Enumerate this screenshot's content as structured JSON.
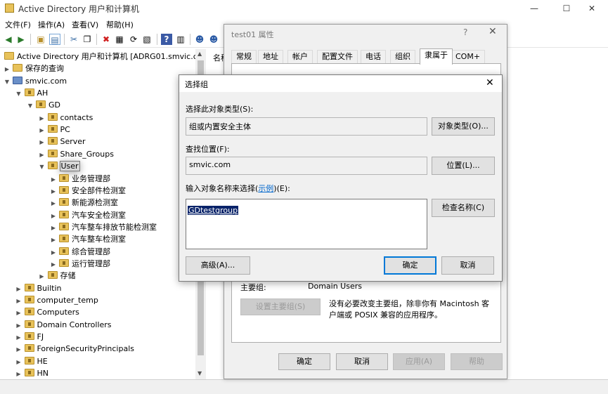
{
  "window": {
    "title": "Active Directory 用户和计算机",
    "min": "—",
    "max": "☐",
    "close": "✕"
  },
  "menu": [
    "文件(F)",
    "操作(A)",
    "查看(V)",
    "帮助(H)"
  ],
  "tree": {
    "root": "Active Directory 用户和计算机 [ADRG01.smvic.com]",
    "saved_queries": "保存的查询",
    "domain": "smvic.com",
    "nodes": [
      {
        "label": "AH",
        "level": 1,
        "expanded": true
      },
      {
        "label": "GD",
        "level": 2,
        "expanded": true
      },
      {
        "label": "contacts",
        "level": 3
      },
      {
        "label": "PC",
        "level": 3
      },
      {
        "label": "Server",
        "level": 3
      },
      {
        "label": "Share_Groups",
        "level": 3
      },
      {
        "label": "User",
        "level": 3,
        "expanded": true,
        "selected": true
      },
      {
        "label": "业务管理部",
        "level": 4
      },
      {
        "label": "安全部件检测室",
        "level": 4
      },
      {
        "label": "新能源检测室",
        "level": 4
      },
      {
        "label": "汽车安全检测室",
        "level": 4
      },
      {
        "label": "汽车整车排放节能检测室",
        "level": 4
      },
      {
        "label": "汽车整车检测室",
        "level": 4
      },
      {
        "label": "综合管理部",
        "level": 4
      },
      {
        "label": "运行管理部",
        "level": 4
      },
      {
        "label": "存储",
        "level": 3
      },
      {
        "label": "Builtin",
        "level": 1
      },
      {
        "label": "computer_temp",
        "level": 1
      },
      {
        "label": "Computers",
        "level": 1
      },
      {
        "label": "Domain Controllers",
        "level": 1
      },
      {
        "label": "FJ",
        "level": 1
      },
      {
        "label": "ForeignSecurityPrincipals",
        "level": 1
      },
      {
        "label": "HE",
        "level": 1
      },
      {
        "label": "HN",
        "level": 1
      }
    ]
  },
  "right_pane": {
    "column": "名称"
  },
  "props": {
    "title": "test01 属性",
    "help": "?",
    "close": "✕",
    "tabs": [
      "常规",
      "地址",
      "帐户",
      "配置文件",
      "电话",
      "组织",
      "隶属于",
      "COM+"
    ],
    "primary_group_label": "主要组:",
    "primary_group_value": "Domain Users",
    "set_primary_button": "设置主要组(S)",
    "note": "没有必要改变主要组，除非你有 Macintosh 客户端或 POSIX 兼容的应用程序。",
    "ok": "确定",
    "cancel": "取消",
    "apply": "应用(A)",
    "help_button": "帮助"
  },
  "select_group": {
    "title": "选择组",
    "close": "✕",
    "object_type_label": "选择此对象类型(S):",
    "object_type_value": "组或内置安全主体",
    "object_type_button": "对象类型(O)...",
    "location_label": "查找位置(F):",
    "location_value": "smvic.com",
    "location_button": "位置(L)...",
    "names_label_pre": "输入对象名称来选择(",
    "names_label_link": "示例",
    "names_label_post": ")(E):",
    "entered_name": "GDtestgroup",
    "check_names_button": "检查名称(C)",
    "advanced_button": "高级(A)...",
    "ok": "确定",
    "cancel": "取消"
  }
}
